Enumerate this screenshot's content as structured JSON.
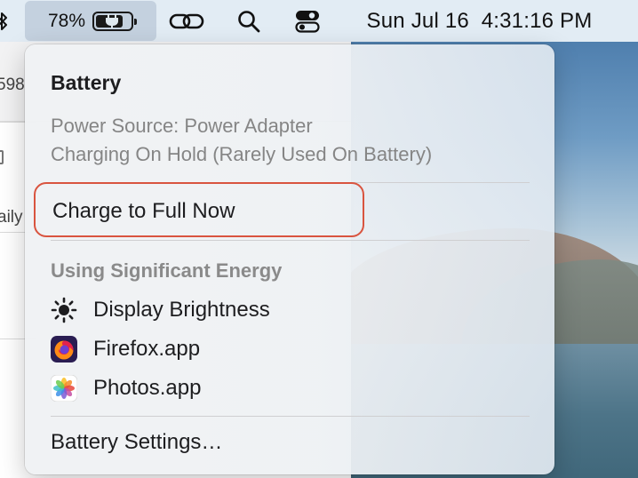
{
  "menubar": {
    "battery_percent": "78%",
    "battery_level": 0.78,
    "clock": "Sun Jul 16  4:31:16 PM",
    "icons": [
      "bluetooth-icon",
      "battery-icon",
      "link-icon",
      "search-icon",
      "control-center-icon"
    ]
  },
  "background_app": {
    "fragments": [
      "598",
      "aily"
    ]
  },
  "battery_menu": {
    "title": "Battery",
    "power_source": "Power Source: Power Adapter",
    "charging_status": "Charging On Hold (Rarely Used On Battery)",
    "charge_full_label": "Charge to Full Now",
    "energy_section_title": "Using Significant Energy",
    "energy_items": [
      {
        "label": "Display Brightness",
        "icon": "brightness-icon"
      },
      {
        "label": "Firefox.app",
        "icon": "firefox-icon"
      },
      {
        "label": "Photos.app",
        "icon": "photos-icon"
      }
    ],
    "settings_label": "Battery Settings…"
  },
  "colors": {
    "highlight_outline": "#d9543f",
    "menu_text": "#1d1d1f",
    "muted_text": "#858585"
  }
}
